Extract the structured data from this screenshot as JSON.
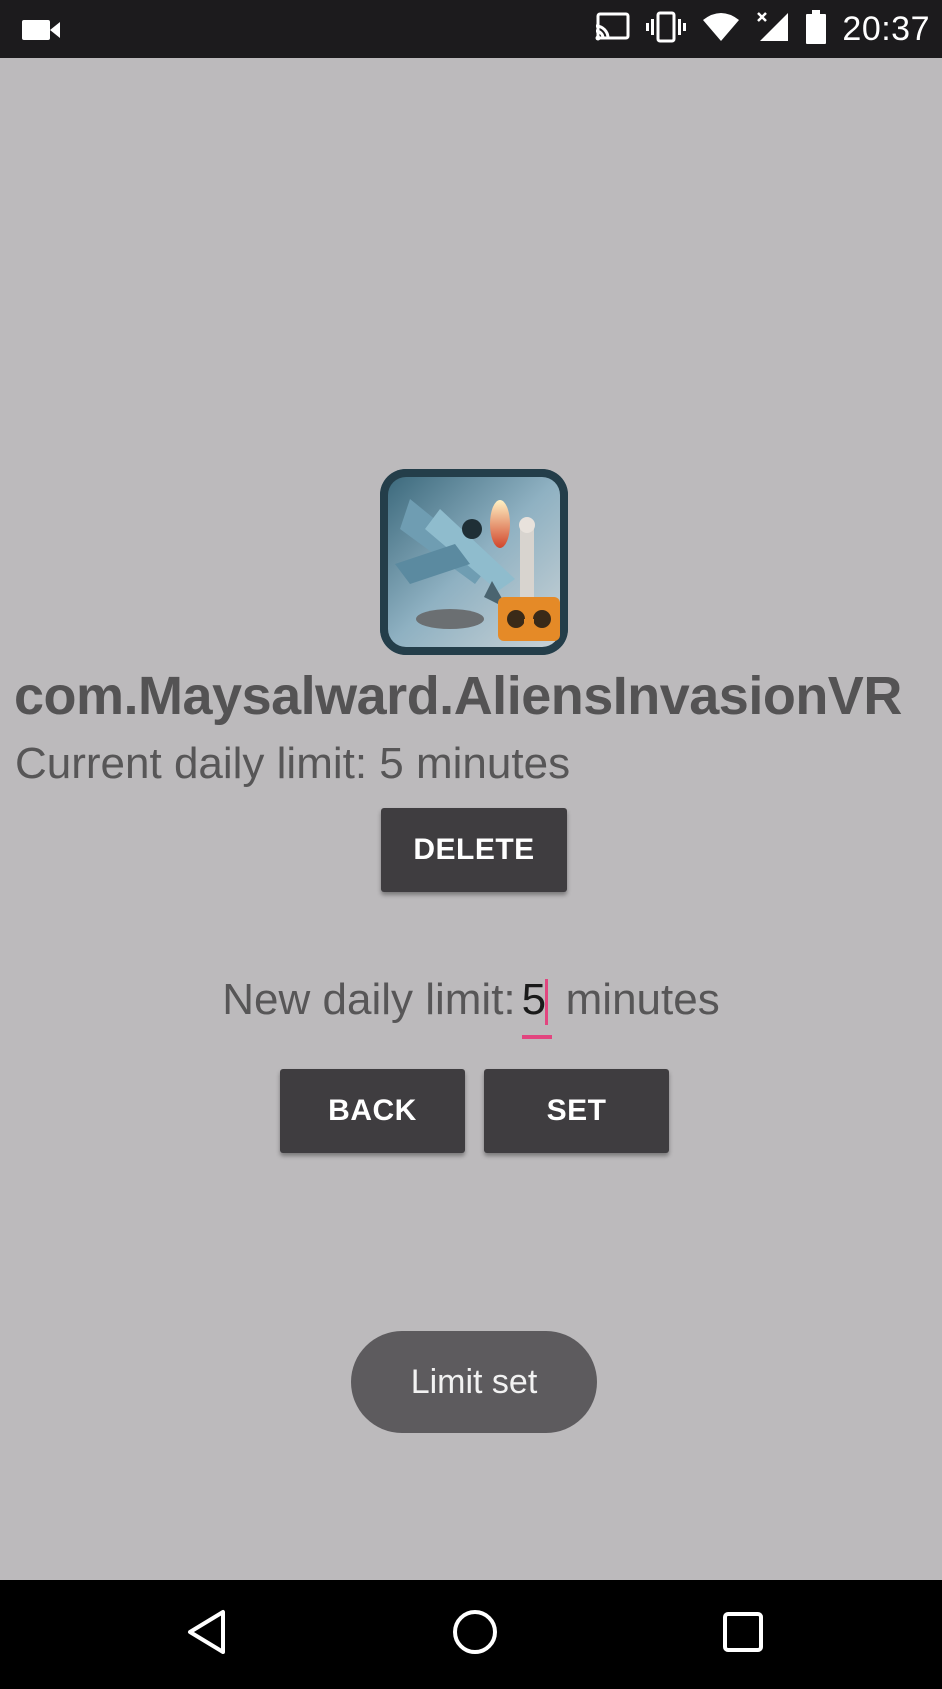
{
  "status_bar": {
    "time": "20:37",
    "left_icon": "video-camera-icon",
    "right_icons": [
      "cast-icon",
      "vibrate-icon",
      "wifi-icon",
      "cell-signal-no-data-icon",
      "battery-icon"
    ]
  },
  "app": {
    "icon": "aliens-invasion-vr-app-icon",
    "package_name": "com.Maysalward.AliensInvasionVR",
    "current_limit_text": "Current daily limit: 5 minutes",
    "delete_label": "DELETE",
    "new_limit": {
      "label": "New daily limit:",
      "value": "5",
      "unit": "minutes"
    },
    "back_label": "BACK",
    "set_label": "SET"
  },
  "toast": {
    "message": "Limit set"
  },
  "nav_bar": {
    "icons": [
      "back-triangle-icon",
      "home-circle-icon",
      "recents-square-icon"
    ]
  },
  "colors": {
    "background": "#bcbabc",
    "button": "#3f3d40",
    "accent": "#e2457f",
    "toast": "#5d5b5e",
    "text": "#575657"
  }
}
